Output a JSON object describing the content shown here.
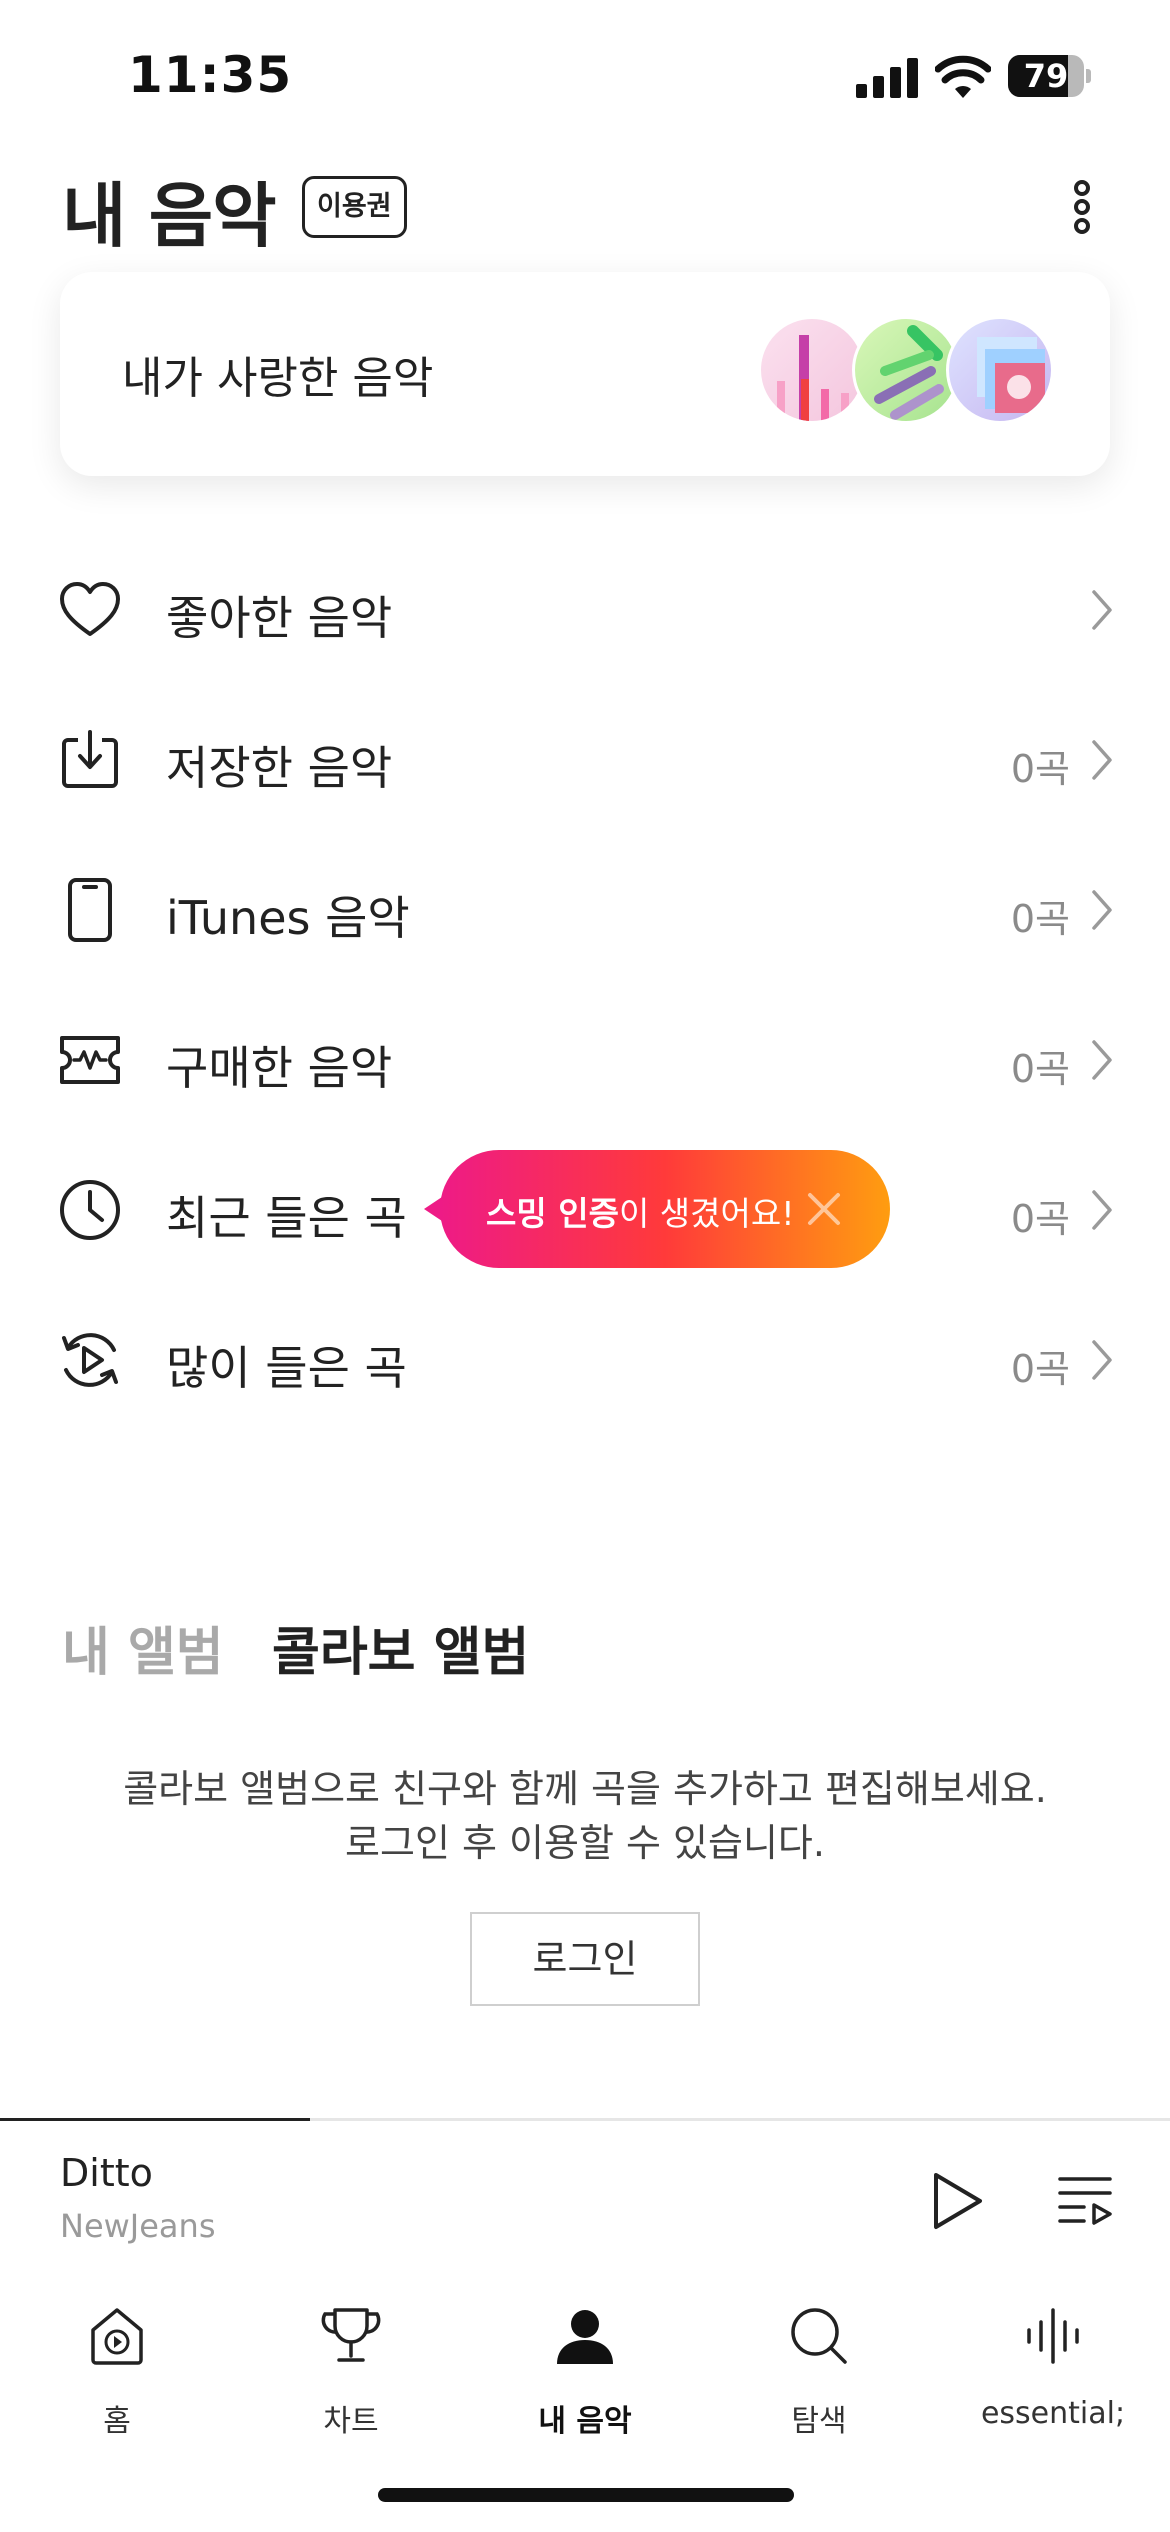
{
  "status_bar": {
    "time": "11:35",
    "battery_level": "79",
    "battery_fraction": 0.79
  },
  "header": {
    "title": "내 음악",
    "pass_badge": "이용권",
    "more_icon": "more-vertical-icon"
  },
  "loved_card": {
    "label": "내가 사랑한 음악"
  },
  "library": {
    "items": [
      {
        "label": "좋아한 음악",
        "count": "",
        "icon": "heart-icon"
      },
      {
        "label": "저장한 음악",
        "count": "0곡",
        "icon": "download-icon"
      },
      {
        "label": "iTunes 음악",
        "count": "0곡",
        "icon": "phone-icon"
      },
      {
        "label": "구매한 음악",
        "count": "0곡",
        "icon": "ticket-icon"
      },
      {
        "label": "최근 들은 곡",
        "count": "0곡",
        "icon": "clock-icon"
      },
      {
        "label": "많이 들은 곡",
        "count": "0곡",
        "icon": "replay-icon"
      }
    ]
  },
  "tooltip": {
    "highlight": "스밍 인증",
    "text": "이 생겼어요!",
    "gradient": [
      "#ee1b86",
      "#ff3a3a",
      "#ff9d10"
    ]
  },
  "albums": {
    "tabs": [
      {
        "label": "내 앨범",
        "active": false
      },
      {
        "label": "콜라보 앨범",
        "active": true
      }
    ],
    "description_line1": "콜라보 앨범으로 친구와 함께 곡을 추가하고 편집해보세요.",
    "description_line2": "로그인 후 이용할 수 있습니다.",
    "login_label": "로그인"
  },
  "player": {
    "title": "Ditto",
    "artist": "NewJeans",
    "progress": 0.265
  },
  "tab_bar": {
    "items": [
      {
        "label": "홈",
        "icon": "home-icon",
        "active": false
      },
      {
        "label": "차트",
        "icon": "trophy-icon",
        "active": false
      },
      {
        "label": "내 음악",
        "icon": "person-icon",
        "active": true
      },
      {
        "label": "탐색",
        "icon": "search-icon",
        "active": false
      },
      {
        "label": "essential;",
        "icon": "waveform-icon",
        "active": false
      }
    ]
  }
}
